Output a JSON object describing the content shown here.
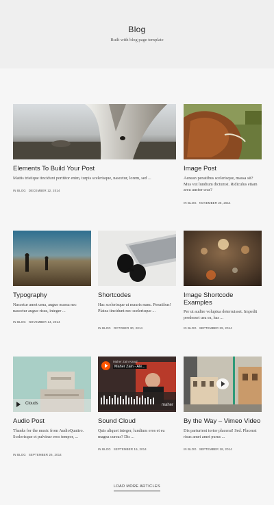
{
  "header": {
    "title": "Blog",
    "subtitle": "Built with blog page template"
  },
  "posts": [
    {
      "title": "Elements To Build Your Post",
      "excerpt": "Mattis tristique tincidunt porttitor enim, turpis scelerisque, nascetur, lorem, sed ...",
      "category_prefix": "IN",
      "category": "BLOG",
      "date": "DECEMBER 12, 2014",
      "image": "horse-closeup"
    },
    {
      "title": "Image Post",
      "excerpt": "Aenean penatibus scelerisque, massa sit? Mus vut lundium dictumst. Ridiculus etiam arcu auctor cras?",
      "category_prefix": "IN",
      "category": "BLOG",
      "date": "NOVEMBER 25, 2014",
      "image": "highland-cow"
    },
    {
      "title": "Typography",
      "excerpt": "Nascetur amet urna, augue massa nec nascetur augue risus, integer ...",
      "category_prefix": "IN",
      "category": "BLOG",
      "date": "NOVEMBER 14, 2014",
      "image": "field-figures"
    },
    {
      "title": "Shortcodes",
      "excerpt": "Hac scelerisque ut mauris nunc. Penatibus! Platea tincidunt nec scelerisque ...",
      "category_prefix": "IN",
      "category": "BLOG",
      "date": "OCTOBER 30, 2014",
      "image": "sunglasses-laptop"
    },
    {
      "title": "Image Shortcode Examples",
      "excerpt": "Per ut audire voluptua deterruisset. Impedit prodesset usu ea, has ...",
      "category_prefix": "IN",
      "category": "BLOG",
      "date": "SEPTEMBER 29, 2014",
      "image": "bokeh-lights"
    },
    {
      "title": "Audio Post",
      "excerpt": "Thanks for the music from AudioQuattro. Scelerisque et pulvinar eros tempor, ...",
      "category_prefix": "IN",
      "category": "BLOG",
      "date": "SEPTEMBER 26, 2014",
      "image": "building",
      "audio_label": "Clouds"
    },
    {
      "title": "Sound Cloud",
      "excerpt": "Quis aliquet integer, lundium eros et eu magna cursus? Dis ...",
      "category_prefix": "IN",
      "category": "BLOG",
      "date": "SEPTEMBER 19, 2014",
      "image": "soundcloud-player",
      "sc_top": "Maher Zain Kanal",
      "sc_track": "Maher Zain - Ale...",
      "sc_brand": "maher"
    },
    {
      "title": "By the Way – Vimeo Video",
      "excerpt": "Dis parturient tortor placerat! Sed. Placerat risus amet amet purus ...",
      "category_prefix": "IN",
      "category": "BLOG",
      "date": "SEPTEMBER 18, 2014",
      "image": "street-video"
    }
  ],
  "load_more": "LOAD MORE ARTICLES"
}
